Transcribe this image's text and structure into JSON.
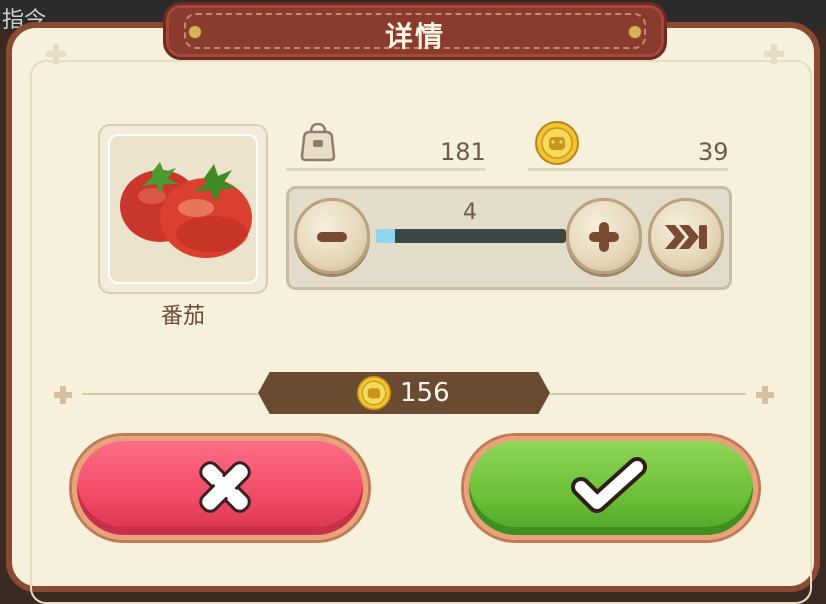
{
  "background": {
    "partial_text": "指令"
  },
  "dialog": {
    "title": "详情"
  },
  "item": {
    "name": "番茄",
    "icon": "tomato-icon"
  },
  "stats": {
    "inventory": {
      "icon": "bag-icon",
      "value": "181"
    },
    "coins": {
      "icon": "coin-icon",
      "value": "39"
    }
  },
  "quantity": {
    "value": "4",
    "fill_fraction": 0.1,
    "minus_icon": "minus-icon",
    "plus_icon": "plus-icon",
    "max_icon": "fast-forward-icon"
  },
  "price": {
    "icon": "coin-icon",
    "total": "156"
  },
  "buttons": {
    "cancel_icon": "close-icon",
    "confirm_icon": "check-icon"
  },
  "colors": {
    "header": "#8b3a2e",
    "cancel": "#f04a67",
    "confirm": "#6cbf36",
    "panel": "#f7f0dd",
    "slider_fill": "#8fd6ee"
  }
}
